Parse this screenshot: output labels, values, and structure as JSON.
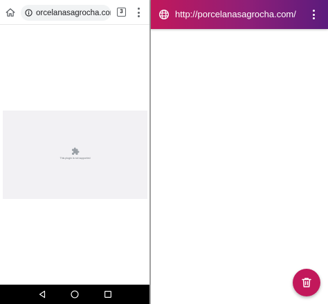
{
  "browser": {
    "url": "orcelanasagrocha.com",
    "tab_count": "3",
    "plugin_message": "This plugin is not supported",
    "icons": {
      "home": "home-icon",
      "info": "info-icon",
      "tabs": "tab-switcher-icon",
      "menu": "more-vert-icon",
      "plugin": "puzzle-piece-icon"
    }
  },
  "system_nav": {
    "icons": [
      "back-icon",
      "home-circle-icon",
      "recents-square-icon"
    ]
  },
  "webapp": {
    "url": "http://porcelanasagrocha.com/",
    "colors": {
      "gradient_start": "#c2185b",
      "gradient_end": "#5b1b7d",
      "fab": "#c2185b"
    },
    "icons": {
      "globe": "globe-icon",
      "menu": "more-vert-icon",
      "fab": "trash-icon"
    }
  }
}
